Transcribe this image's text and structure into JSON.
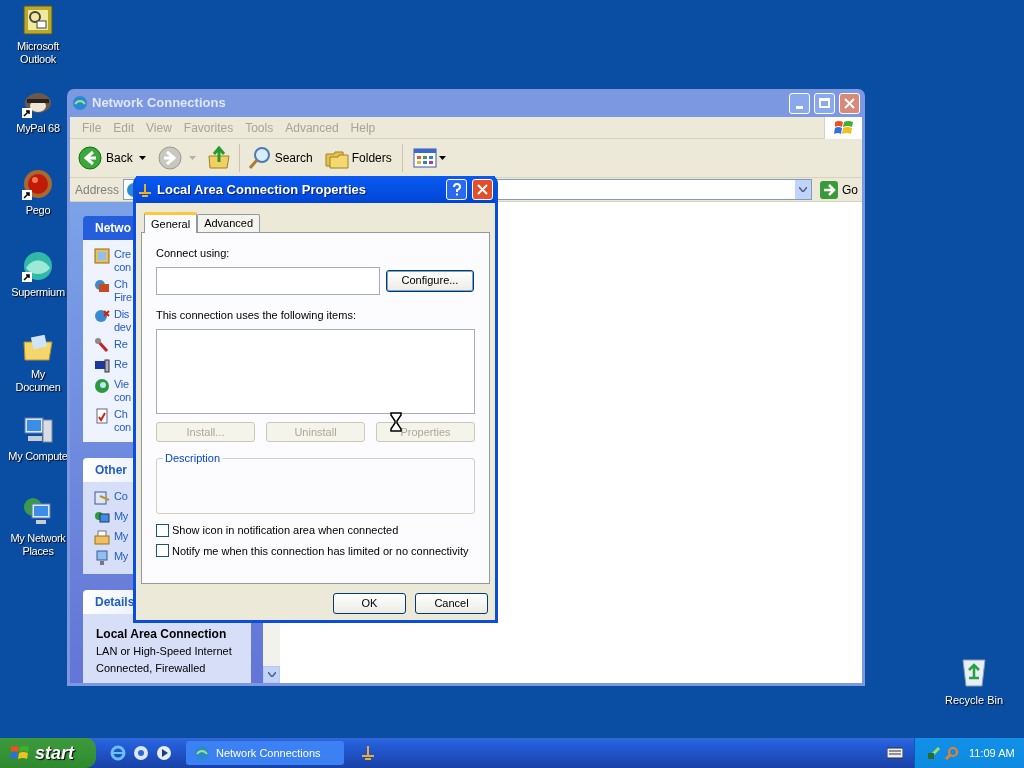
{
  "desktop_icons": [
    {
      "label": "Microsoft Outlook",
      "shortcut": false
    },
    {
      "label": "MyPal 68",
      "shortcut": true
    },
    {
      "label": "Pego",
      "shortcut": true
    },
    {
      "label": "Supermium",
      "shortcut": true
    },
    {
      "label": "My Documen",
      "shortcut": false
    },
    {
      "label": "My Compute",
      "shortcut": false
    },
    {
      "label": "My Network Places",
      "shortcut": false
    }
  ],
  "recycle_bin": {
    "label": "Recycle Bin"
  },
  "explorer": {
    "title": "Network Connections",
    "active": false,
    "menu": [
      {
        "label": "File",
        "disabled": true
      },
      {
        "label": "Edit",
        "disabled": true
      },
      {
        "label": "View",
        "disabled": true
      },
      {
        "label": "Favorites",
        "disabled": true
      },
      {
        "label": "Tools",
        "disabled": true
      },
      {
        "label": "Advanced",
        "disabled": true
      },
      {
        "label": "Help",
        "disabled": true
      }
    ],
    "toolbar": {
      "back": "Back",
      "search": "Search",
      "folders": "Folders"
    },
    "address": {
      "label": "Address",
      "go": "Go"
    },
    "sidebar": {
      "panels": [
        {
          "title": "Netwo",
          "special": true,
          "items": [
            {
              "lines": [
                "Cre",
                "con"
              ]
            },
            {
              "lines": [
                "Ch",
                "Fire"
              ]
            },
            {
              "lines": [
                "Dis",
                "dev"
              ]
            },
            {
              "lines": [
                "Re"
              ]
            },
            {
              "lines": [
                "Re"
              ]
            },
            {
              "lines": [
                "Vie",
                "con"
              ]
            },
            {
              "lines": [
                "Ch",
                "con"
              ]
            }
          ]
        },
        {
          "title": "Other",
          "special": false,
          "items": [
            {
              "lines": [
                "Co"
              ]
            },
            {
              "lines": [
                "My"
              ]
            },
            {
              "lines": [
                "My"
              ]
            },
            {
              "lines": [
                "My"
              ]
            }
          ]
        }
      ],
      "details": {
        "title": "Details",
        "name": "Local Area Connection",
        "lines": [
          "LAN or High-Speed Internet",
          "Connected, Firewalled"
        ]
      }
    }
  },
  "dialog": {
    "title": "Local Area Connection Properties",
    "tabs": [
      {
        "label": "General",
        "selected": true
      },
      {
        "label": "Advanced",
        "selected": false
      }
    ],
    "connect_label": "Connect using:",
    "configure": "Configure...",
    "items_label": "This connection uses the following items:",
    "item_buttons": [
      {
        "label": "Install...",
        "disabled": true
      },
      {
        "label": "Uninstall",
        "disabled": true
      },
      {
        "label": "Properties",
        "disabled": true
      }
    ],
    "description_label": "Description",
    "checkboxes": [
      {
        "label": "Show icon in notification area when connected",
        "checked": false
      },
      {
        "label": "Notify me when this connection has limited or no connectivity",
        "checked": false
      }
    ],
    "buttons": [
      "OK",
      "Cancel"
    ]
  },
  "taskbar": {
    "start": "start",
    "tasks": [
      {
        "kind": "window",
        "label": "Network Connections"
      },
      {
        "kind": "icon"
      }
    ],
    "clock": "11:09 AM"
  }
}
